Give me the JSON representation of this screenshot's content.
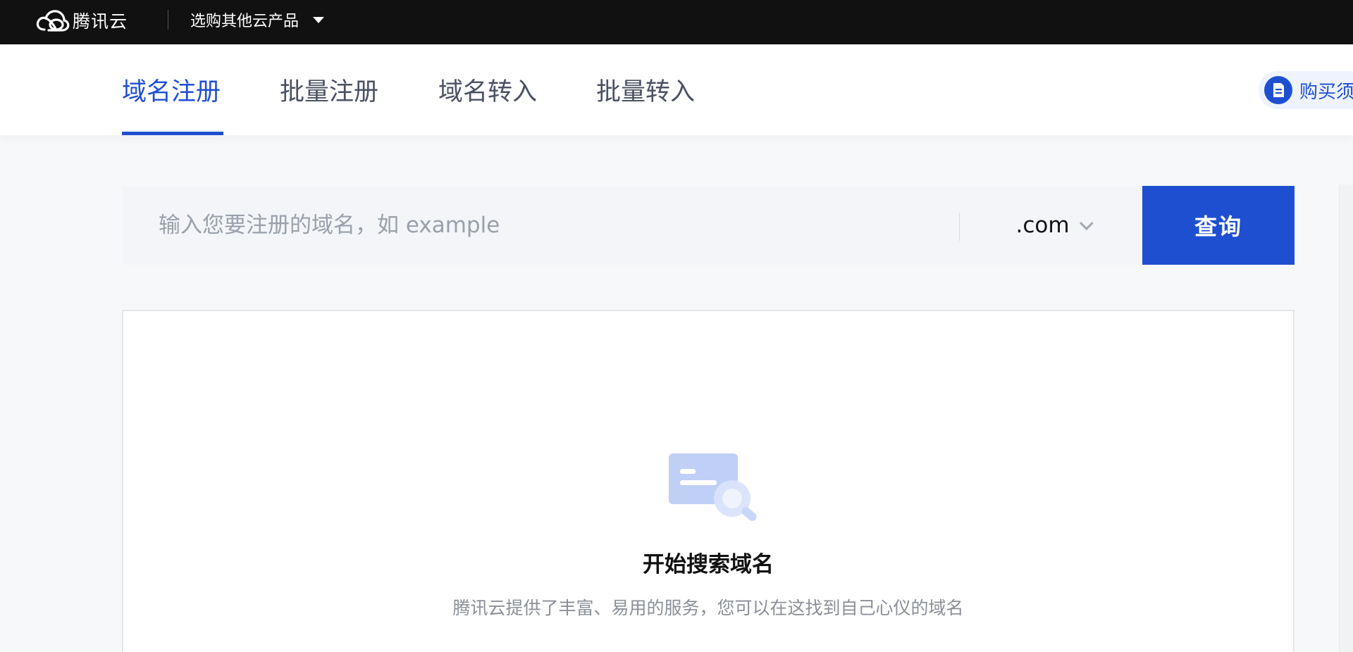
{
  "topbar": {
    "logo_text": "腾讯云",
    "product_menu_label": "选购其他云产品"
  },
  "tabs": [
    {
      "label": "域名注册",
      "active": true
    },
    {
      "label": "批量注册",
      "active": false
    },
    {
      "label": "域名转入",
      "active": false
    },
    {
      "label": "批量转入",
      "active": false
    }
  ],
  "notice": {
    "label": "购买须知"
  },
  "search": {
    "placeholder": "输入您要注册的域名，如 example",
    "value": "",
    "suffix": ".com",
    "button_label": "查询"
  },
  "empty_state": {
    "title": "开始搜索域名",
    "description": "腾讯云提供了丰富、易用的服务，您可以在这找到自己心仪的域名"
  },
  "colors": {
    "topbar_bg": "#111111",
    "accent": "#1f4fd1",
    "search_bg": "#f3f5f9"
  }
}
